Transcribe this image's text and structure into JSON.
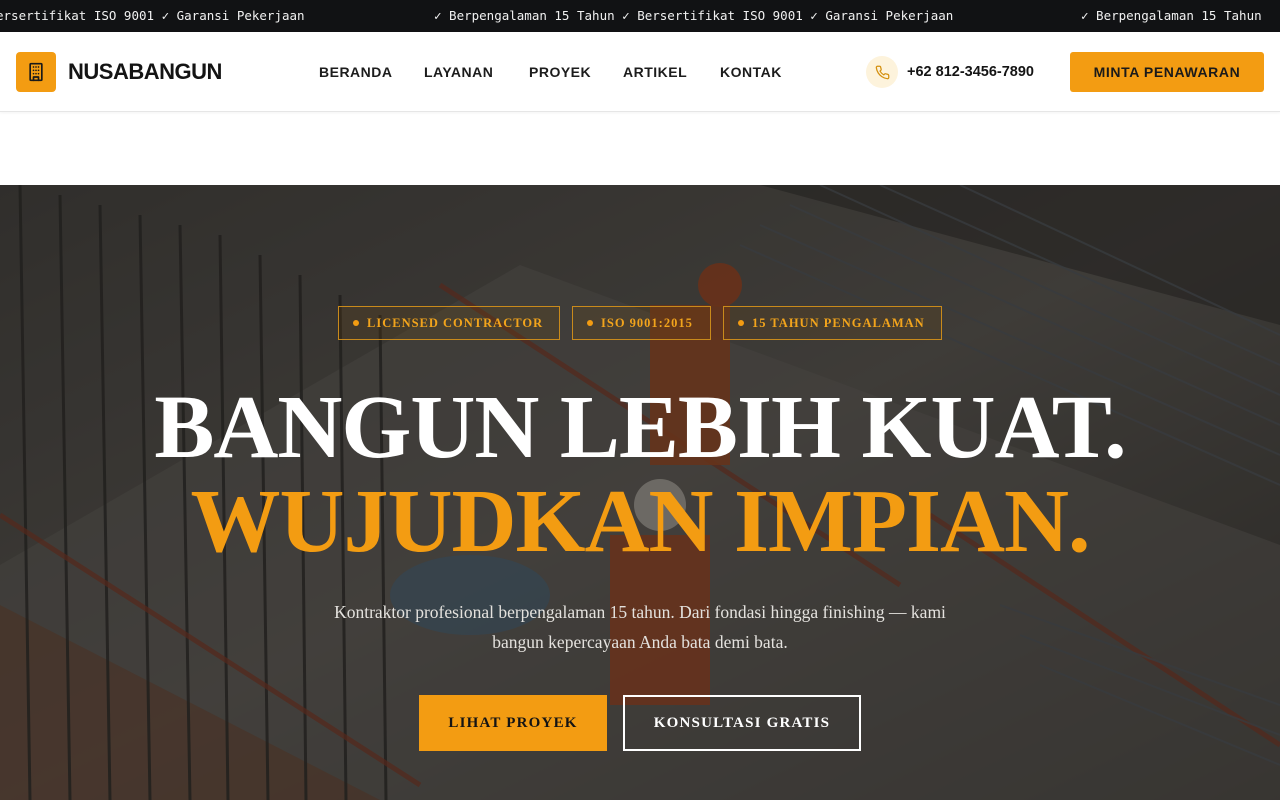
{
  "ticker": {
    "items": [
      "ersertifikat ISO 9001 ✓ Garansi Pekerjaan",
      "✓ Berpengalaman 15 Tahun ✓ Bersertifikat ISO 9001 ✓ Garansi Pekerjaan",
      "✓ Berpengalaman 15 Tahun"
    ]
  },
  "nav": {
    "brand": "NUSABANGUN",
    "logo_icon": "building-icon",
    "links": [
      "BERANDA",
      "LAYANAN",
      "PROYEK",
      "ARTIKEL",
      "KONTAK"
    ],
    "phone_icon": "phone-icon",
    "phone": "+62 812-3456-7890",
    "cta": "MINTA PENAWARAN"
  },
  "hero": {
    "badges": [
      "LICENSED CONTRACTOR",
      "ISO 9001:2015",
      "15 TAHUN PENGALAMAN"
    ],
    "headline_line1": "BANGUN LEBIH KUAT.",
    "headline_line2": "WUJUDKAN IMPIAN.",
    "subtitle": "Kontraktor profesional berpengalaman 15 tahun. Dari fondasi hingga finishing — kami bangun kepercayaan Anda bata demi bata.",
    "primary_button": "LIHAT PROYEK",
    "secondary_button": "KONSULTASI GRATIS"
  },
  "colors": {
    "accent": "#f39c12",
    "dark": "#111214",
    "text": "#141414"
  }
}
